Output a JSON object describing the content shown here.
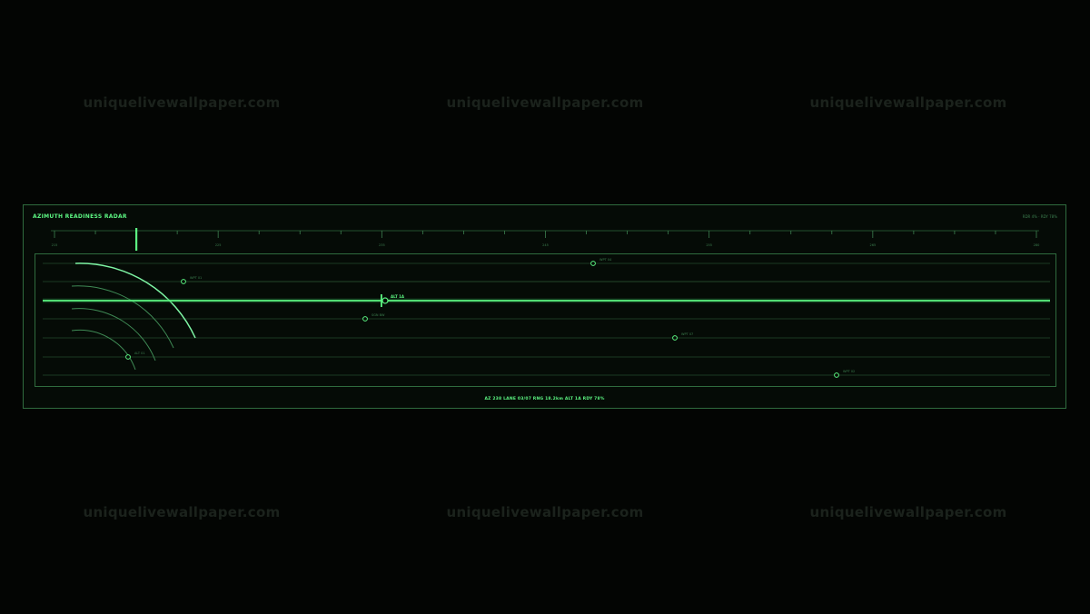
{
  "watermark": "uniquelivewallpaper.com",
  "panel": {
    "title": "AZIMUTH READINESS RADAR",
    "status": "RDR 4% · RDY 78%",
    "ruler_labels": [
      "215",
      "",
      "",
      "",
      "",
      "",
      "",
      "",
      "",
      "",
      "",
      "",
      "",
      "",
      "",
      "",
      "",
      "",
      "",
      "",
      "",
      "",
      "",
      "",
      "",
      ""
    ],
    "ruler_tick_labels": [
      "215",
      "225",
      "235",
      "245",
      "255",
      "265",
      "280"
    ],
    "cursor_label": "ALT 1A",
    "readout": "AZ 238  LANE 03/07  RNG 18.2km  ALT 1A  RDY 78%"
  },
  "targets": [
    {
      "id": "wpt-01",
      "label": "WPT 01"
    },
    {
      "id": "wpt-04",
      "label": "WPT 04"
    },
    {
      "id": "sgn-bw",
      "label": "SGN BW"
    },
    {
      "id": "wpt-07",
      "label": "WPT 07"
    },
    {
      "id": "alt-01",
      "label": "ALT 01"
    },
    {
      "id": "wpt-02",
      "label": "WPT 02"
    }
  ],
  "colors": {
    "accent": "#5cf582",
    "frame": "#2f6b3e",
    "dim": "#3d8050",
    "background": "#030503"
  }
}
